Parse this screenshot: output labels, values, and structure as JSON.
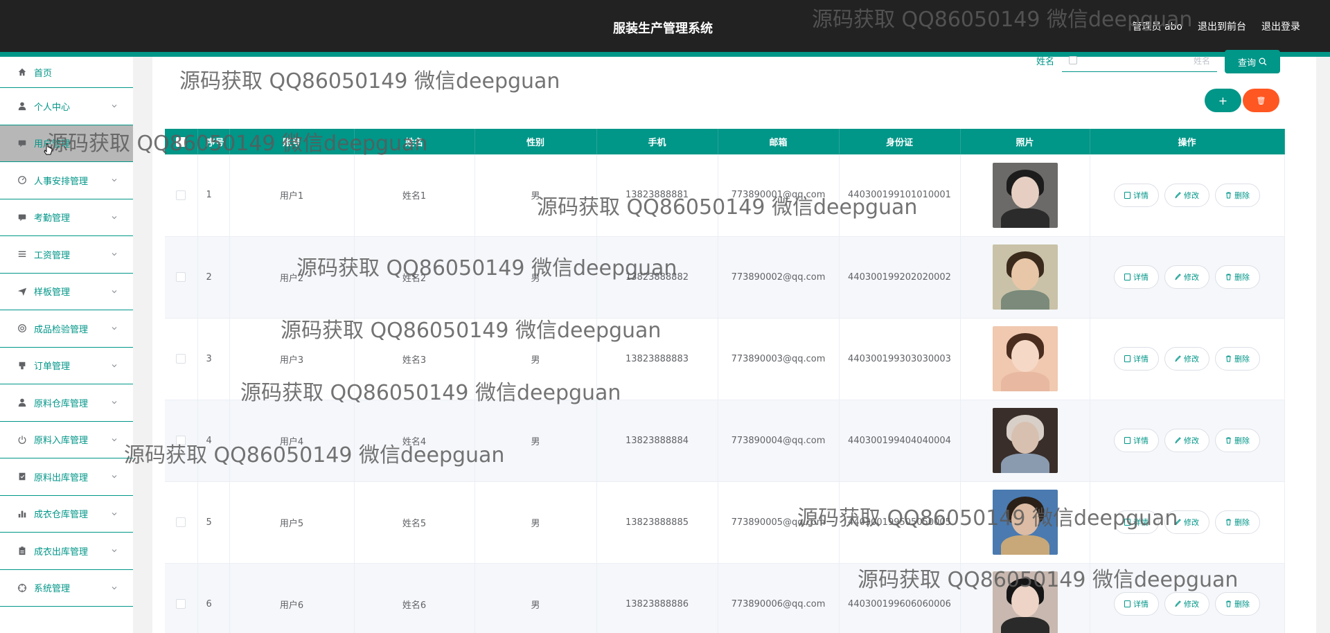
{
  "header": {
    "title": "服装生产管理系统",
    "admin_label": "管理员 abo",
    "front_link": "退出到前台",
    "logout_link": "退出登录"
  },
  "sidebar": {
    "items": [
      {
        "label": "首页",
        "icon": "home-icon"
      },
      {
        "label": "个人中心",
        "icon": "user-icon"
      },
      {
        "label": "用户管理",
        "icon": "chat-icon"
      },
      {
        "label": "人事安排管理",
        "icon": "gauge-icon"
      },
      {
        "label": "考勤管理",
        "icon": "chat-icon"
      },
      {
        "label": "工资管理",
        "icon": "list-icon"
      },
      {
        "label": "样板管理",
        "icon": "send-icon"
      },
      {
        "label": "成品检验管理",
        "icon": "target-icon"
      },
      {
        "label": "订单管理",
        "icon": "stamp-icon"
      },
      {
        "label": "原料仓库管理",
        "icon": "user-icon"
      },
      {
        "label": "原料入库管理",
        "icon": "power-icon"
      },
      {
        "label": "原料出库管理",
        "icon": "box-icon"
      },
      {
        "label": "成衣仓库管理",
        "icon": "bar-chart-icon"
      },
      {
        "label": "成衣出库管理",
        "icon": "clipboard-icon"
      },
      {
        "label": "系统管理",
        "icon": "crosshair-icon"
      }
    ]
  },
  "search": {
    "label": "姓名",
    "placeholder": "姓名",
    "button": "查询"
  },
  "actions": {
    "add": "+",
    "delete": "🗑"
  },
  "table": {
    "headers": [
      "序号",
      "账号",
      "姓名",
      "性别",
      "手机",
      "邮箱",
      "身份证",
      "照片",
      "操作"
    ],
    "rows": [
      {
        "index": "1",
        "account": "用户1",
        "name": "姓名1",
        "gender": "男",
        "phone": "13823888881",
        "email": "773890001@qq.com",
        "idcard": "440300199101010001"
      },
      {
        "index": "2",
        "account": "用户2",
        "name": "姓名2",
        "gender": "男",
        "phone": "13823888882",
        "email": "773890002@qq.com",
        "idcard": "440300199202020002"
      },
      {
        "index": "3",
        "account": "用户3",
        "name": "姓名3",
        "gender": "男",
        "phone": "13823888883",
        "email": "773890003@qq.com",
        "idcard": "440300199303030003"
      },
      {
        "index": "4",
        "account": "用户4",
        "name": "姓名4",
        "gender": "男",
        "phone": "13823888884",
        "email": "773890004@qq.com",
        "idcard": "440300199404040004"
      },
      {
        "index": "5",
        "account": "用户5",
        "name": "姓名5",
        "gender": "男",
        "phone": "13823888885",
        "email": "773890005@qq.com",
        "idcard": "440300199505050005"
      },
      {
        "index": "6",
        "account": "用户6",
        "name": "姓名6",
        "gender": "男",
        "phone": "13823888886",
        "email": "773890006@qq.com",
        "idcard": "440300199606060006"
      }
    ],
    "ops": {
      "detail": "详情",
      "edit": "修改",
      "remove": "删除"
    }
  },
  "watermark": "源码获取 QQ86050149 微信deepguan",
  "colors": {
    "accent": "#009688",
    "danger": "#ff5722",
    "header_bg": "#222222"
  }
}
